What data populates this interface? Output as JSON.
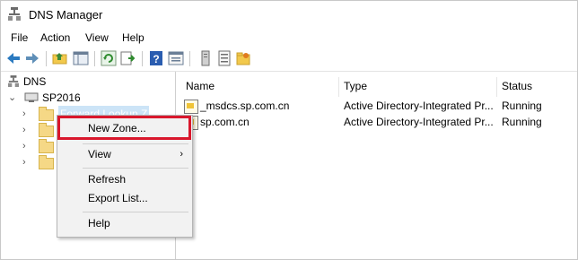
{
  "window": {
    "title": "DNS Manager"
  },
  "menu": {
    "items": [
      "File",
      "Action",
      "View",
      "Help"
    ]
  },
  "toolbar": {
    "icons": [
      "back-arrow-icon",
      "forward-arrow-icon",
      "up-folder-icon",
      "show-hide-tree-icon",
      "refresh-icon",
      "export-list-icon",
      "help-icon",
      "properties-icon",
      "server-icon",
      "list-icon",
      "new-folder-icon"
    ]
  },
  "tree": {
    "root": "DNS",
    "server": "SP2016",
    "folder_partial_label": "Forward Lookup Z"
  },
  "list": {
    "headers": [
      "Name",
      "Type",
      "Status"
    ],
    "rows": [
      {
        "name": "_msdcs.sp.com.cn",
        "type": "Active Directory-Integrated Pr...",
        "status": "Running"
      },
      {
        "name": "sp.com.cn",
        "type": "Active Directory-Integrated Pr...",
        "status": "Running"
      }
    ]
  },
  "context_menu": {
    "items": [
      "New Zone...",
      "View",
      "Refresh",
      "Export List...",
      "Help"
    ],
    "highlighted": "New Zone..."
  },
  "colors": {
    "highlight_border": "#d9172c",
    "menu_background": "#f2f2f2"
  }
}
